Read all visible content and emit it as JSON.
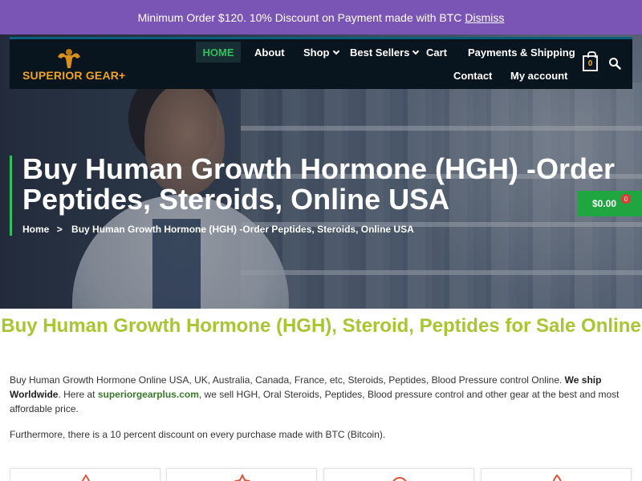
{
  "promo": {
    "text": "Minimum Order $120. 10% Discount on Payment made with BTC",
    "dismiss": "Dismiss"
  },
  "header": {
    "logo_text": "SUPERIOR GEAR+",
    "nav": {
      "home": "HOME",
      "about": "About",
      "shop": "Shop",
      "best_sellers": "Best Sellers",
      "cart": "Cart",
      "payments": "Payments & Shipping",
      "contact": "Contact",
      "account": "My account"
    },
    "cart_count": "0"
  },
  "hero": {
    "title": "Buy Human Growth Hormone (HGH) -Order Peptides, Steroids, Online USA",
    "breadcrumb_home": "Home",
    "breadcrumb_sep": ">",
    "breadcrumb_current": "Buy Human Growth Hormone (HGH) -Order Peptides, Steroids, Online USA",
    "cart_total": "$0.00",
    "cart_badge": "0"
  },
  "content": {
    "heading": "Buy Human Growth Hormone (HGH), Steroid, Peptides for Sale Online",
    "p1_a": "Buy Human Growth Hormone Online USA, UK, Australia, Canada, France, etc, Steroids, Peptides, Blood Pressure control Online.",
    "p1_bold": "We ship Worldwide",
    "p1_b": ". Here at",
    "p1_link": "superiorgearplus.com",
    "p1_c": ", we sell HGH, Oral Steroids, Peptides, Blood pressure control and other gear at the best and most affordable price.",
    "p2": "Furthermore, there is a 10 percent discount on every purchase made with BTC (Bitcoin)."
  },
  "colors": {
    "promo_bg": "#7b55b5",
    "header_bg": "#08141e",
    "accent_green": "#2fbf5f",
    "heading_green": "#a8c632",
    "logo_orange": "#f1a51e",
    "cart_button": "#1fa640"
  },
  "icons": [
    "muscle-logo-icon",
    "chevron-down-icon",
    "cart-icon",
    "search-icon",
    "chevron-right-icon",
    "flame-icon",
    "flame-icon",
    "circle-icon",
    "flame-icon"
  ]
}
